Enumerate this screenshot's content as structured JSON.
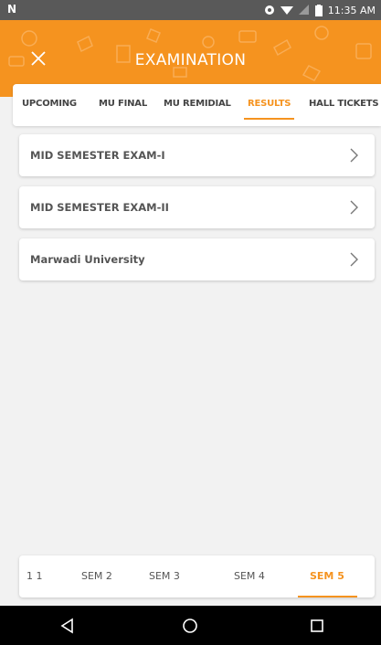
{
  "status_bar": {
    "time": "11:35 AM"
  },
  "header": {
    "title": "EXAMINATION"
  },
  "tabs": [
    {
      "label": "UPCOMING",
      "active": false
    },
    {
      "label": "MU FINAL",
      "active": false
    },
    {
      "label": "MU REMIDIAL",
      "active": false
    },
    {
      "label": "RESULTS",
      "active": true
    },
    {
      "label": "HALL TICKETS",
      "active": false
    }
  ],
  "results": [
    {
      "label": "MID SEMESTER EXAM-I"
    },
    {
      "label": "MID SEMESTER EXAM-II"
    },
    {
      "label": "Marwadi University"
    }
  ],
  "semesters": [
    {
      "label": "1 1",
      "active": false
    },
    {
      "label": "SEM 2",
      "active": false
    },
    {
      "label": "SEM 3",
      "active": false
    },
    {
      "label": "SEM 4",
      "active": false
    },
    {
      "label": "SEM 5",
      "active": true
    }
  ],
  "colors": {
    "accent": "#f5931f",
    "status_bar": "#595959"
  }
}
